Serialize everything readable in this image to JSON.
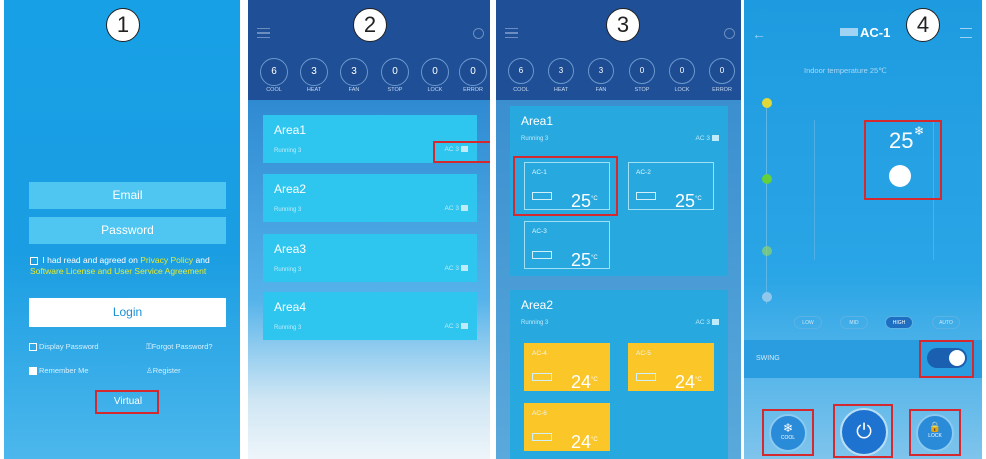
{
  "steps": [
    "1",
    "2",
    "3",
    "4"
  ],
  "login": {
    "email": "Email",
    "password": "Password",
    "agree_prefix": "I had read and agreed on",
    "privacy": "Privacy Policy",
    "and": "and",
    "license": "Software License and User Service Agreement",
    "login_button": "Login",
    "display_password": "Display Password",
    "forgot_password": "Forgot Password?",
    "remember_me": "Remember Me",
    "register": "Register",
    "virtual": "Virtual"
  },
  "status": [
    {
      "count": "6",
      "label": "COOL"
    },
    {
      "count": "3",
      "label": "HEAT"
    },
    {
      "count": "3",
      "label": "FAN"
    },
    {
      "count": "0",
      "label": "STOP"
    },
    {
      "count": "0",
      "label": "LOCK"
    },
    {
      "count": "0",
      "label": "ERROR"
    }
  ],
  "areas": [
    {
      "name": "Area1",
      "running": "Running 3",
      "ac": "AC 3"
    },
    {
      "name": "Area2",
      "running": "Running 3",
      "ac": "AC 3"
    },
    {
      "name": "Area3",
      "running": "Running 3",
      "ac": "AC 3"
    },
    {
      "name": "Area4",
      "running": "Running 3",
      "ac": "AC 3"
    }
  ],
  "area1_units": [
    {
      "name": "AC-1",
      "temp": "25",
      "unit": "°C"
    },
    {
      "name": "AC-2",
      "temp": "25",
      "unit": "°C"
    },
    {
      "name": "AC-3",
      "temp": "25",
      "unit": "°C"
    }
  ],
  "area2_units": [
    {
      "name": "AC-4",
      "temp": "24",
      "unit": "°C"
    },
    {
      "name": "AC-5",
      "temp": "24",
      "unit": "°C"
    },
    {
      "name": "AC-6",
      "temp": "24",
      "unit": "°C"
    }
  ],
  "detail": {
    "title": "AC-1",
    "indoor": "Indoor temperature  25℃",
    "setpoint": "25",
    "modes": [
      "LOW",
      "MID",
      "HIGH",
      "AUTO"
    ],
    "swing": "SWING",
    "cool": "COOL",
    "lock": "LOCK"
  },
  "colors": {
    "accent": "#d42a2f",
    "login_bg": "#1a9de2",
    "dark_header": "#1f4f97",
    "area_cyan": "#2ec6ef",
    "card_yellow": "#fbc628",
    "link_yellow": "#e6ea2c"
  }
}
